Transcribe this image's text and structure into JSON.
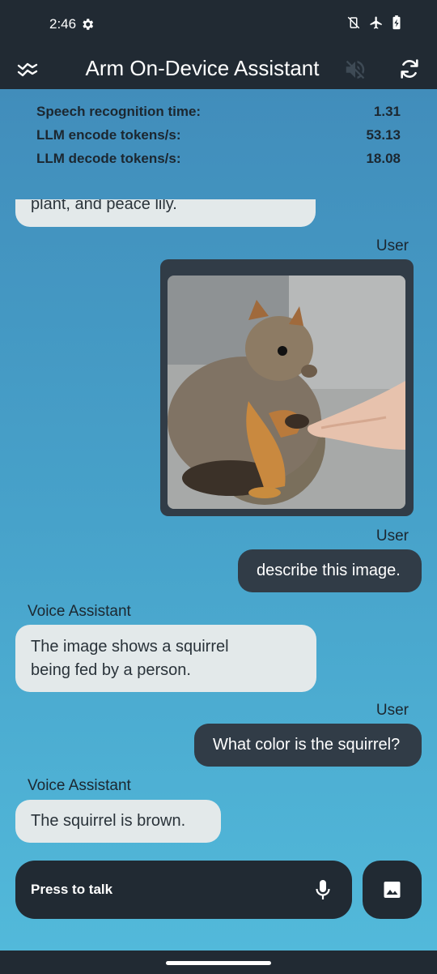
{
  "status_bar": {
    "time": "2:46",
    "icons": [
      "gear-icon",
      "vibrate-off-icon",
      "airplane-icon",
      "battery-charging-icon"
    ]
  },
  "app_bar": {
    "title": "Arm On-Device Assistant",
    "icons": [
      "menu-icon",
      "volume-off-icon",
      "refresh-icon"
    ]
  },
  "stats": [
    {
      "label": "Speech recognition time:",
      "value": "1.31"
    },
    {
      "label": "LLM encode tokens/s:",
      "value": "53.13"
    },
    {
      "label": "LLM decode tokens/s:",
      "value": "18.08"
    }
  ],
  "chat": {
    "partial_assistant": "plant, and peace lily.",
    "user_label": "User",
    "assistant_label": "Voice Assistant",
    "messages": [
      {
        "role": "user",
        "text": "describe this image."
      },
      {
        "role": "assistant",
        "lines": [
          "The image shows a squirrel",
          "being fed by a person."
        ]
      },
      {
        "role": "user",
        "text": "What color is the squirrel?"
      },
      {
        "role": "assistant",
        "text": "The squirrel is brown."
      }
    ]
  },
  "input": {
    "label": "Press to talk",
    "icons": [
      "microphone-icon",
      "image-icon"
    ]
  },
  "colors": {
    "bar": "#212a33",
    "gradient_top": "#418dbb",
    "gradient_bottom": "#52b9da",
    "assistant_bubble": "#e3e9ea",
    "user_bubble": "#313c47"
  }
}
